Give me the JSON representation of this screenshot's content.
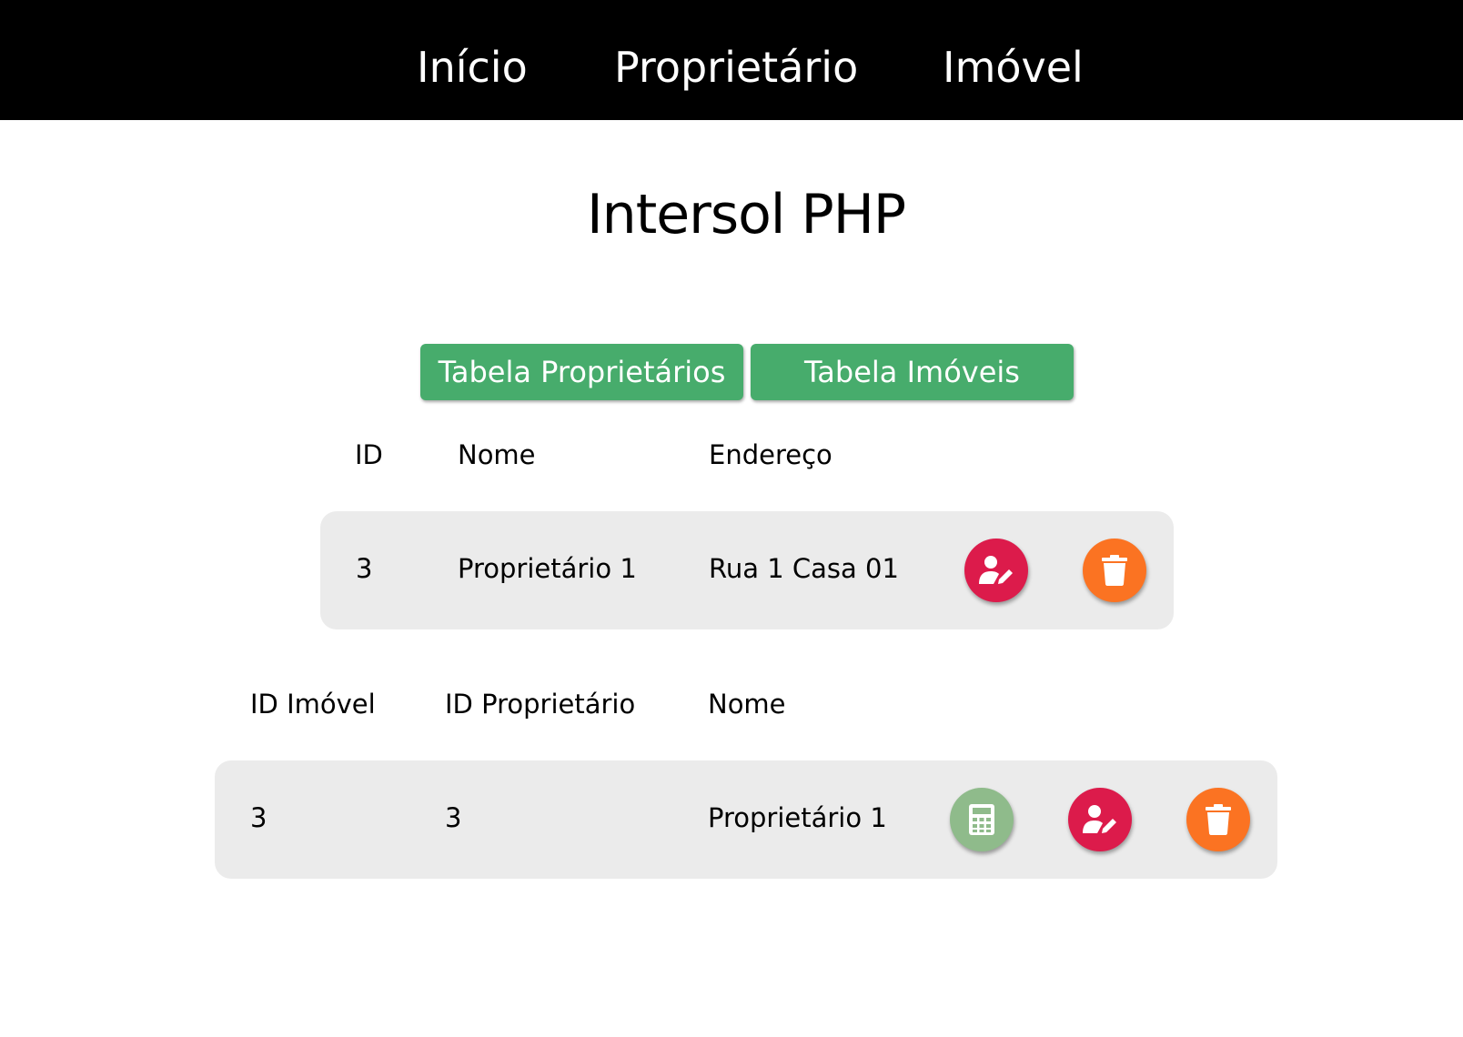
{
  "nav": {
    "items": [
      {
        "label": "Início"
      },
      {
        "label": "Proprietário"
      },
      {
        "label": "Imóvel"
      }
    ]
  },
  "page": {
    "title": "Intersol PHP"
  },
  "tabs": {
    "proprietarios_label": "Tabela Proprietários",
    "imoveis_label": "Tabela Imóveis"
  },
  "proprietarios_table": {
    "headers": [
      "ID",
      "Nome",
      "Endereço"
    ],
    "rows": [
      {
        "id": "3",
        "nome": "Proprietário 1",
        "endereco": "Rua 1 Casa 01"
      }
    ],
    "actions": [
      "edit-user-icon",
      "trash-icon"
    ]
  },
  "imoveis_table": {
    "headers": [
      "ID Imóvel",
      "ID Proprietário",
      "Nome"
    ],
    "rows": [
      {
        "id_imovel": "3",
        "id_proprietario": "3",
        "nome": "Proprietário 1"
      }
    ],
    "actions": [
      "calculator-icon",
      "edit-user-icon",
      "trash-icon"
    ]
  },
  "colors": {
    "navbar": "#000000",
    "tab_button": "#47ac6c",
    "row_background": "#ebebeb",
    "edit_button": "#dc1b4b",
    "delete_button": "#fb7322",
    "calc_button": "#8fbb8b"
  }
}
